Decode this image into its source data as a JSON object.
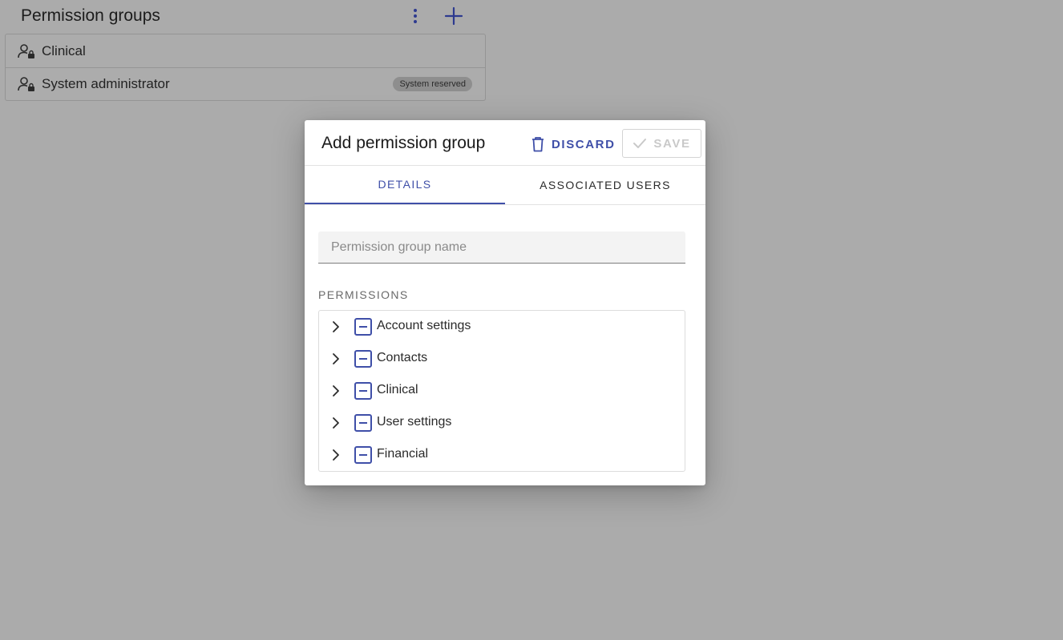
{
  "page": {
    "title": "Permission groups",
    "groups": [
      {
        "label": "Clinical",
        "badge": ""
      },
      {
        "label": "System administrator",
        "badge": "System reserved"
      }
    ]
  },
  "dialog": {
    "title": "Add permission group",
    "discard_label": "DISCARD",
    "save_label": "SAVE",
    "tabs": [
      {
        "label": "DETAILS",
        "active": true
      },
      {
        "label": "ASSOCIATED USERS",
        "active": false
      }
    ],
    "name_field": {
      "placeholder": "Permission group name",
      "value": ""
    },
    "permissions_heading": "PERMISSIONS",
    "permissions": [
      {
        "label": "Account settings",
        "state": "indeterminate"
      },
      {
        "label": "Contacts",
        "state": "indeterminate"
      },
      {
        "label": "Clinical",
        "state": "indeterminate"
      },
      {
        "label": "User settings",
        "state": "indeterminate"
      },
      {
        "label": "Financial",
        "state": "indeterminate"
      }
    ]
  },
  "colors": {
    "accent": "#3f4fa8",
    "overlay": "#ababab",
    "disabled": "#c9c9c9"
  },
  "icons": {
    "more": "more-vertical-icon",
    "add": "plus-icon",
    "group": "user-lock-icon",
    "discard": "trash-icon",
    "save": "check-icon",
    "expand": "chevron-right-icon",
    "checkbox": "indeterminate-checkbox-icon"
  }
}
